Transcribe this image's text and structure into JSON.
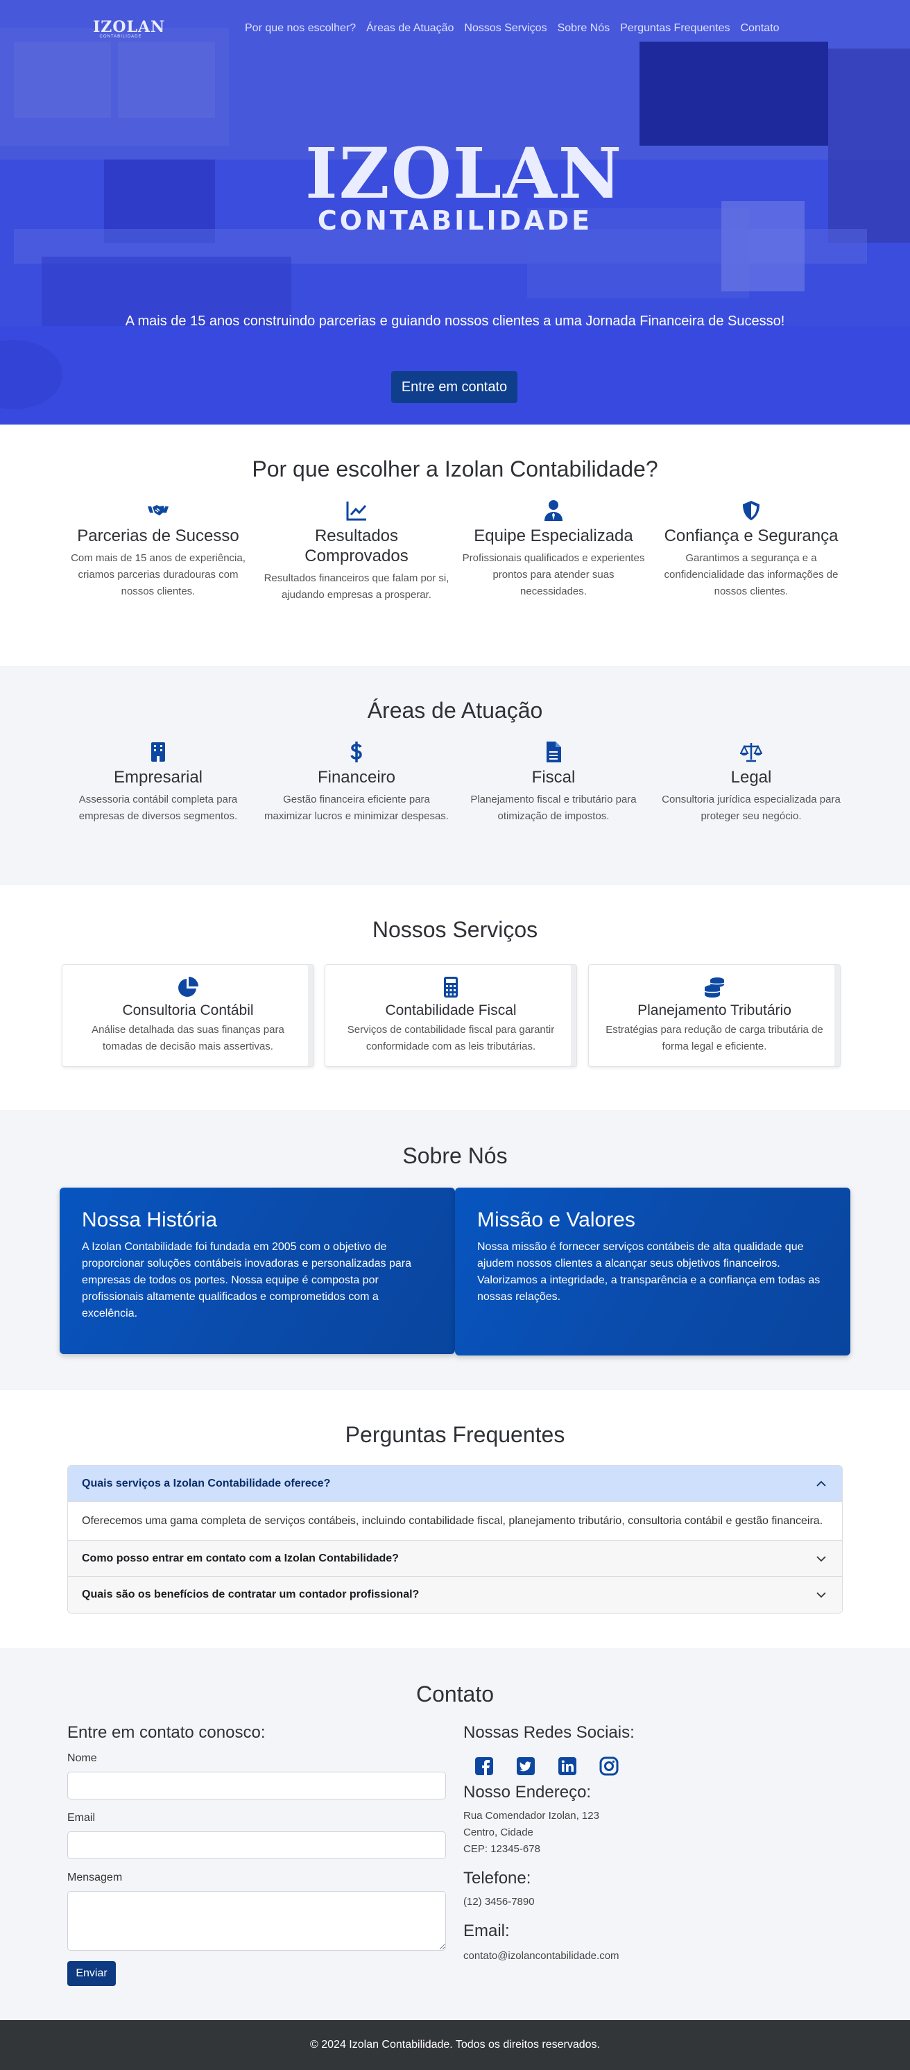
{
  "brand": {
    "logo_main": "IZOLAN",
    "logo_sub": "CONTABILIDADE"
  },
  "nav": {
    "items": [
      "Por que nos escolher?",
      "Áreas de Atuação",
      "Nossos Serviços",
      "Sobre Nós",
      "Perguntas Frequentes",
      "Contato"
    ]
  },
  "hero": {
    "tagline": "A mais de 15 anos construindo parcerias e guiando nossos clientes a uma Jornada Financeira de Sucesso!",
    "cta": "Entre em contato"
  },
  "why": {
    "title": "Por que escolher a Izolan Contabilidade?",
    "items": [
      {
        "icon": "handshake-icon",
        "title": "Parcerias de Sucesso",
        "text": "Com mais de 15 anos de experiência, criamos parcerias duradouras com nossos clientes."
      },
      {
        "icon": "chart-line-icon",
        "title": "Resultados Comprovados",
        "text": "Resultados financeiros que falam por si, ajudando empresas a prosperar."
      },
      {
        "icon": "user-tie-icon",
        "title": "Equipe Especializada",
        "text": "Profissionais qualificados e experientes prontos para atender suas necessidades."
      },
      {
        "icon": "shield-icon",
        "title": "Confiança e Segurança",
        "text": "Garantimos a segurança e a confidencialidade das informações de nossos clientes."
      }
    ]
  },
  "areas": {
    "title": "Áreas de Atuação",
    "items": [
      {
        "icon": "building-icon",
        "title": "Empresarial",
        "text": "Assessoria contábil completa para empresas de diversos segmentos."
      },
      {
        "icon": "dollar-icon",
        "title": "Financeiro",
        "text": "Gestão financeira eficiente para maximizar lucros e minimizar despesas."
      },
      {
        "icon": "file-icon",
        "title": "Fiscal",
        "text": "Planejamento fiscal e tributário para otimização de impostos."
      },
      {
        "icon": "scale-icon",
        "title": "Legal",
        "text": "Consultoria jurídica especializada para proteger seu negócio."
      }
    ]
  },
  "services": {
    "title": "Nossos Serviços",
    "items": [
      {
        "icon": "pie-chart-icon",
        "title": "Consultoria Contábil",
        "text": "Análise detalhada das suas finanças para tomadas de decisão mais assertivas."
      },
      {
        "icon": "calculator-icon",
        "title": "Contabilidade Fiscal",
        "text": "Serviços de contabilidade fiscal para garantir conformidade com as leis tributárias."
      },
      {
        "icon": "coins-icon",
        "title": "Planejamento Tributário",
        "text": "Estratégias para redução de carga tributária de forma legal e eficiente."
      }
    ]
  },
  "about": {
    "title": "Sobre Nós",
    "history": {
      "title": "Nossa História",
      "text": "A Izolan Contabilidade foi fundada em 2005 com o objetivo de proporcionar soluções contábeis inovadoras e personalizadas para empresas de todos os portes. Nossa equipe é composta por profissionais altamente qualificados e comprometidos com a excelência."
    },
    "mission": {
      "title": "Missão e Valores",
      "text": "Nossa missão é fornecer serviços contábeis de alta qualidade que ajudem nossos clientes a alcançar seus objetivos financeiros. Valorizamos a integridade, a transparência e a confiança em todas as nossas relações."
    }
  },
  "faq": {
    "title": "Perguntas Frequentes",
    "items": [
      {
        "q": "Quais serviços a Izolan Contabilidade oferece?",
        "a": "Oferecemos uma gama completa de serviços contábeis, incluindo contabilidade fiscal, planejamento tributário, consultoria contábil e gestão financeira.",
        "open": true
      },
      {
        "q": "Como posso entrar em contato com a Izolan Contabilidade?",
        "open": false
      },
      {
        "q": "Quais são os benefícios de contratar um contador profissional?",
        "open": false
      }
    ]
  },
  "contact": {
    "title": "Contato",
    "form_title": "Entre em contato conosco:",
    "name_label": "Nome",
    "email_label": "Email",
    "message_label": "Mensagem",
    "name_value": "",
    "email_value": "",
    "message_value": "",
    "submit": "Enviar",
    "social_title": "Nossas Redes Sociais:",
    "social_icons": [
      "facebook-icon",
      "twitter-icon",
      "linkedin-icon",
      "instagram-icon"
    ],
    "address_title": "Nosso Endereço:",
    "address_lines": [
      "Rua Comendador Izolan, 123",
      "Centro, Cidade",
      "CEP: 12345-678"
    ],
    "phone_title": "Telefone:",
    "phone": "(12) 3456-7890",
    "email_title": "Email:",
    "email": "contato@izolancontabilidade.com"
  },
  "footer": {
    "text": "© 2024 Izolan Contabilidade. Todos os direitos reservados."
  },
  "colors": {
    "accent": "#0d47a1",
    "button": "#0f3e8c",
    "hero_tint": "#3a4ee6",
    "card_gradient": "#0855c0"
  }
}
